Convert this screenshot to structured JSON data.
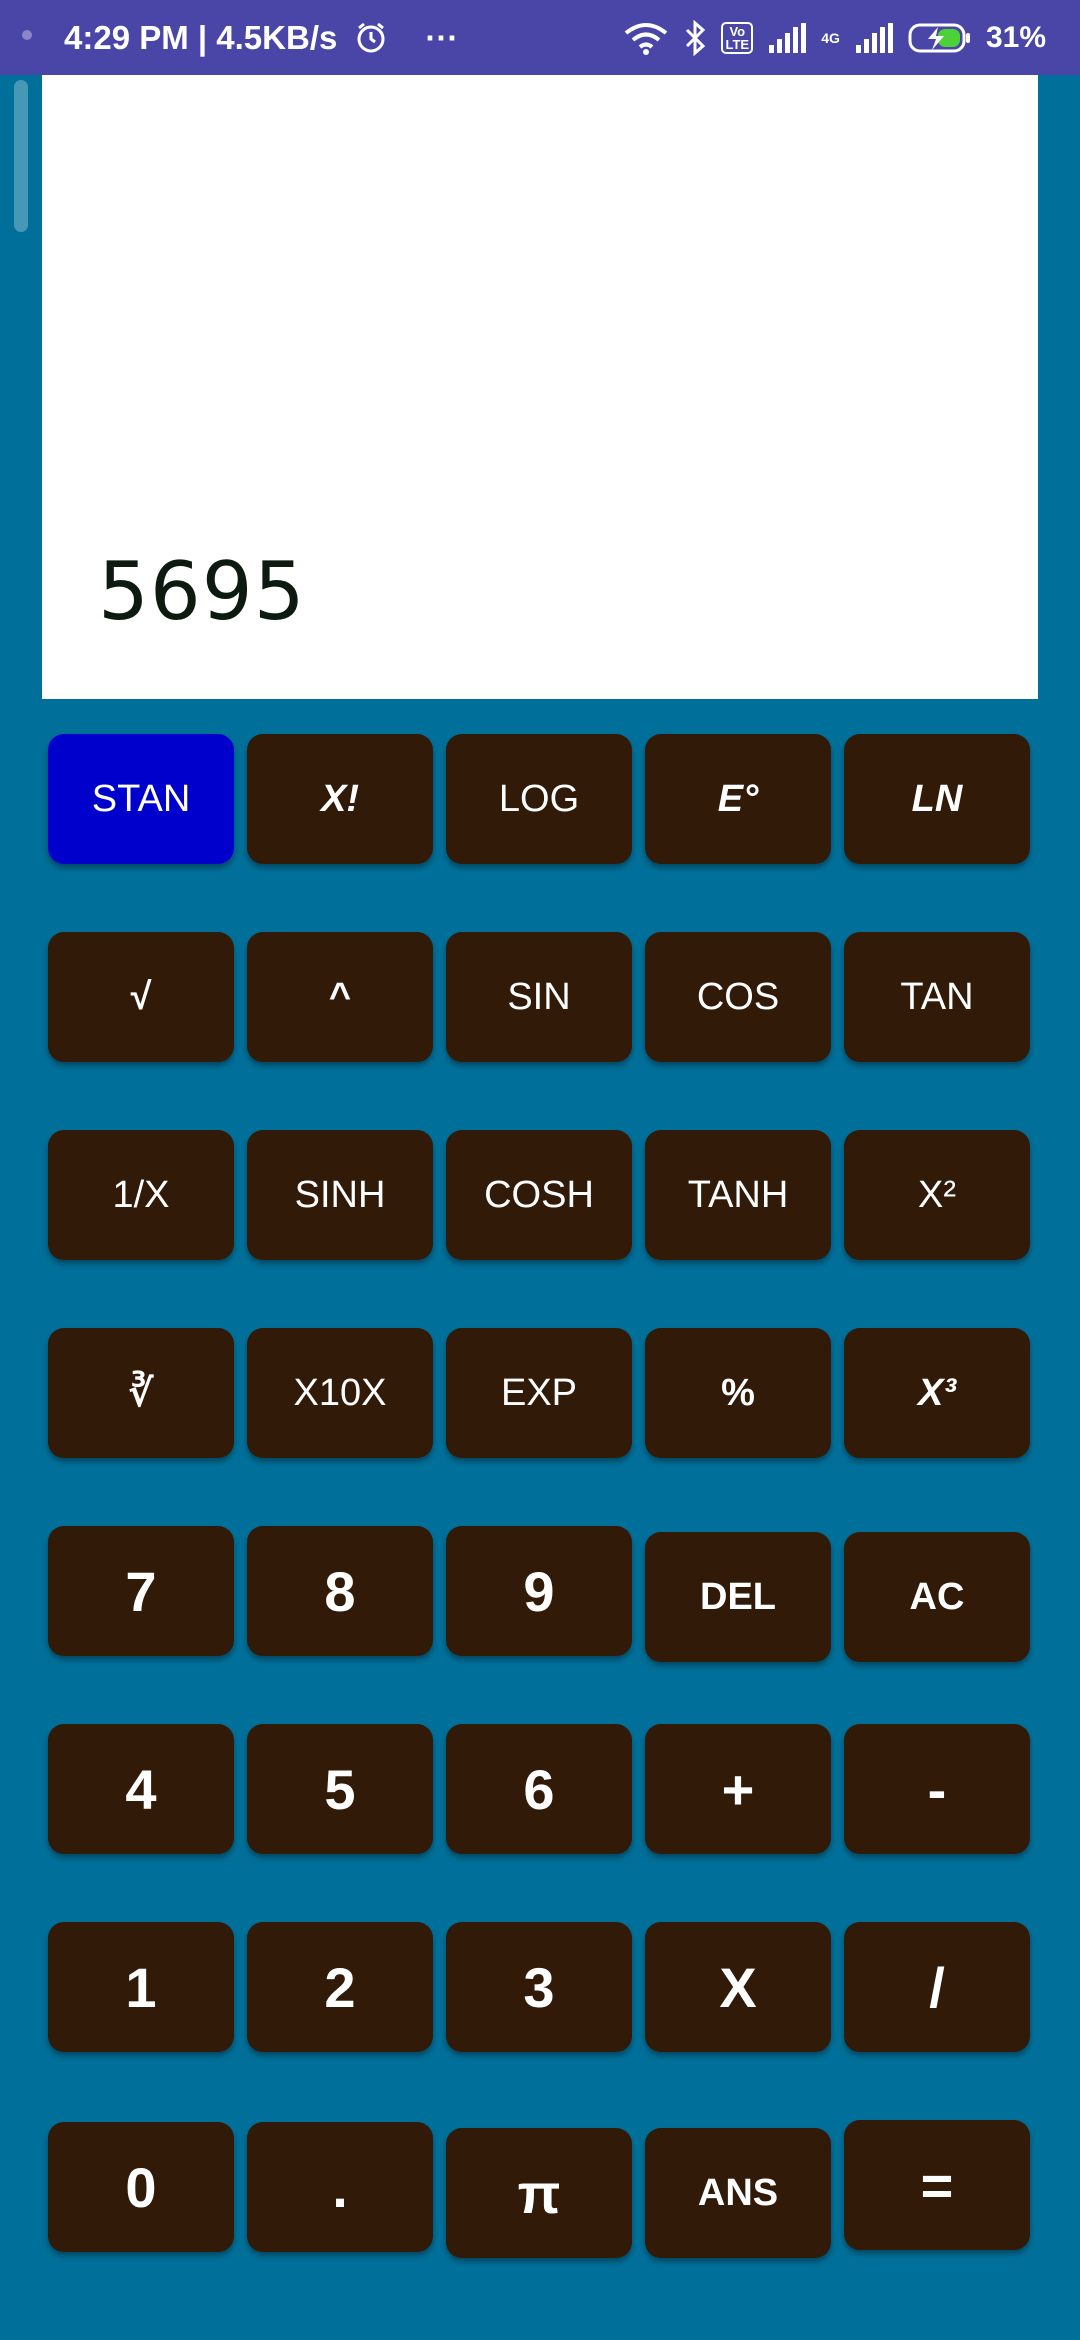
{
  "status_bar": {
    "time_speed": "4:29 PM | 4.5KB/s",
    "more": "···",
    "volte": "Vo LTE",
    "network_4g": "4G",
    "battery": "31%"
  },
  "display": {
    "value": "5695"
  },
  "keys": [
    {
      "label": "STAN",
      "name": "stan-button"
    },
    {
      "label": "X!",
      "name": "factorial-button"
    },
    {
      "label": "LOG",
      "name": "log-button"
    },
    {
      "label": "E°",
      "name": "e-power-button"
    },
    {
      "label": "LN",
      "name": "ln-button"
    },
    {
      "label": "√",
      "name": "sqrt-button"
    },
    {
      "label": "^",
      "name": "power-button"
    },
    {
      "label": "SIN",
      "name": "sin-button"
    },
    {
      "label": "COS",
      "name": "cos-button"
    },
    {
      "label": "TAN",
      "name": "tan-button"
    },
    {
      "label": "1/X",
      "name": "reciprocal-button"
    },
    {
      "label": "SINH",
      "name": "sinh-button"
    },
    {
      "label": "COSH",
      "name": "cosh-button"
    },
    {
      "label": "TANH",
      "name": "tanh-button"
    },
    {
      "label": "X²",
      "name": "square-button"
    },
    {
      "label": "∛",
      "name": "cube-root-button"
    },
    {
      "label": "X10X",
      "name": "x10x-button"
    },
    {
      "label": "EXP",
      "name": "exp-button"
    },
    {
      "label": "%",
      "name": "percent-button"
    },
    {
      "label": "X³",
      "name": "cube-button"
    },
    {
      "label": "7",
      "name": "digit-7-button"
    },
    {
      "label": "8",
      "name": "digit-8-button"
    },
    {
      "label": "9",
      "name": "digit-9-button"
    },
    {
      "label": "DEL",
      "name": "delete-button"
    },
    {
      "label": "AC",
      "name": "all-clear-button"
    },
    {
      "label": "4",
      "name": "digit-4-button"
    },
    {
      "label": "5",
      "name": "digit-5-button"
    },
    {
      "label": "6",
      "name": "digit-6-button"
    },
    {
      "label": "+",
      "name": "add-button"
    },
    {
      "label": "-",
      "name": "subtract-button"
    },
    {
      "label": "1",
      "name": "digit-1-button"
    },
    {
      "label": "2",
      "name": "digit-2-button"
    },
    {
      "label": "3",
      "name": "digit-3-button"
    },
    {
      "label": "X",
      "name": "multiply-button"
    },
    {
      "label": "/",
      "name": "divide-button"
    },
    {
      "label": "0",
      "name": "digit-0-button"
    },
    {
      "label": ".",
      "name": "decimal-point-button"
    },
    {
      "label": "π",
      "name": "pi-button"
    },
    {
      "label": "ANS",
      "name": "answer-button"
    },
    {
      "label": "=",
      "name": "equals-button"
    }
  ],
  "colors": {
    "background": "#00709a",
    "status_bar": "#4a46a8",
    "key": "#311a07",
    "key_active": "#0000cd",
    "display": "#ffffff"
  }
}
